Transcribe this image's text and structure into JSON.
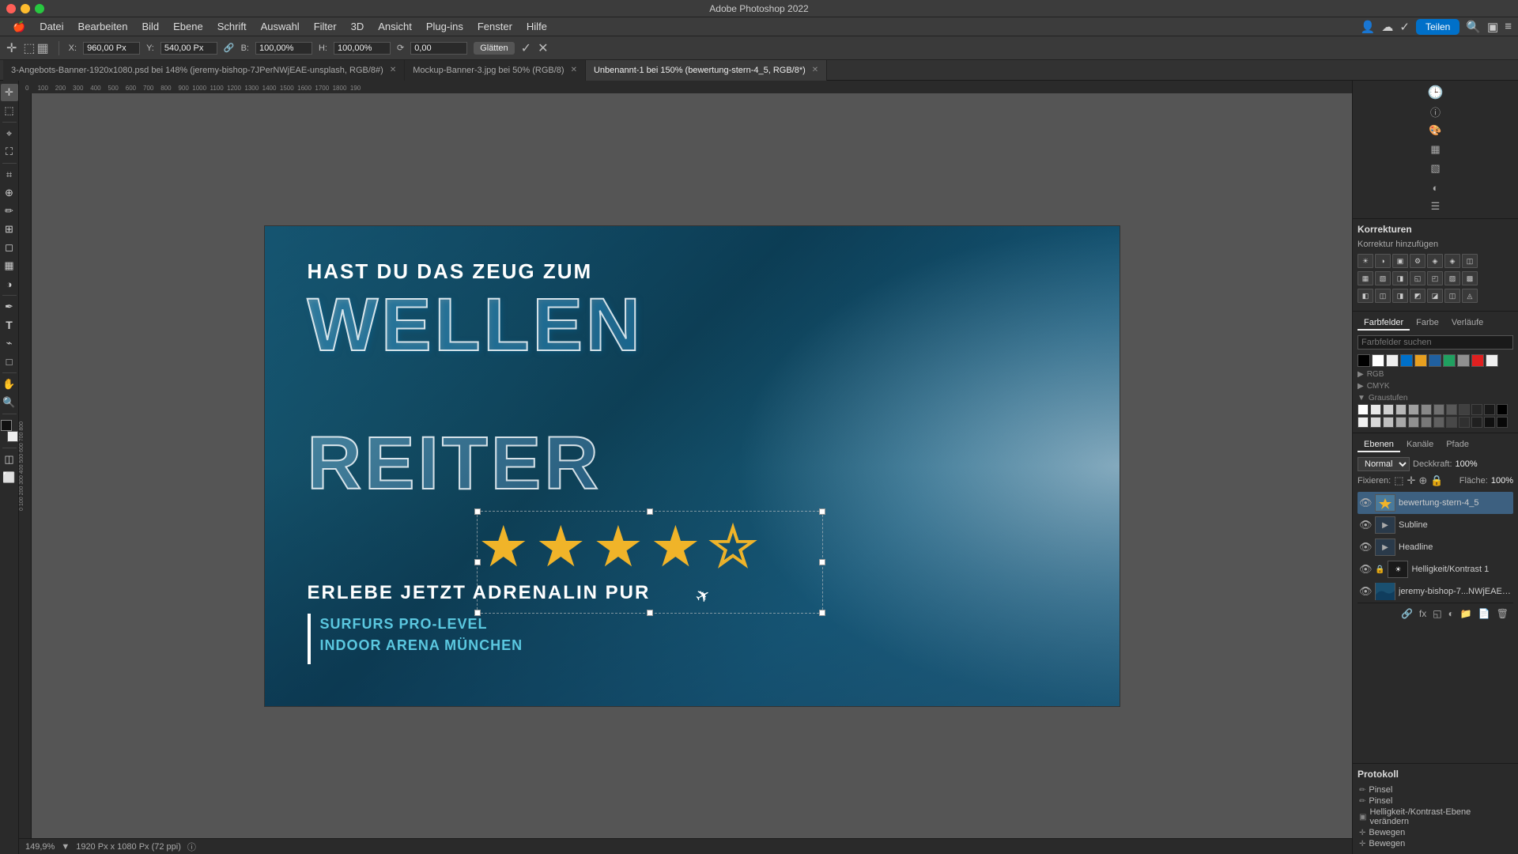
{
  "titlebar": {
    "title": "Adobe Photoshop 2022"
  },
  "menubar": {
    "items": [
      "",
      "Datei",
      "Bearbeiten",
      "Bild",
      "Ebene",
      "Schrift",
      "Auswahl",
      "Filter",
      "3D",
      "Ansicht",
      "Plug-ins",
      "Fenster",
      "Hilfe"
    ]
  },
  "optionsbar": {
    "x_label": "X:",
    "x_value": "960,00 Px",
    "y_label": "Y:",
    "y_value": "540,00 Px",
    "b_label": "B:",
    "b_value": "100,00%",
    "h_label": "H:",
    "h_value": "100,00%",
    "angle_label": "∆",
    "angle_value": "0,00",
    "mode_label": "Glätten",
    "share_label": "Teilen"
  },
  "tabs": [
    {
      "label": "3-Angebots-Banner-1920x1080.psd bei 148% (jeremy-bishop-7JPerNWjEAE-unsplash, RGB/8#)",
      "active": false,
      "closable": true
    },
    {
      "label": "Mockup-Banner-3.jpg bei 50% (RGB/8)",
      "active": false,
      "closable": true
    },
    {
      "label": "Unbenannt-1 bei 150% (bewertung-stern-4_5, RGB/8*)",
      "active": true,
      "closable": true
    }
  ],
  "canvas": {
    "headline": "HAST DU DAS ZEUG ZUM",
    "big_text_1": "WELLEN",
    "big_text_2": "REITER",
    "stars": [
      "filled",
      "filled",
      "filled",
      "filled",
      "empty"
    ],
    "bottom_headline": "ERLEBE JETZT ADRENALIN PUR",
    "sub_line1": "SURFURS PRO-LEVEL",
    "sub_line2": "INDOOR ARENA MÜNCHEN"
  },
  "right_panel": {
    "korrekturen": {
      "title": "Korrekturen",
      "subtitle": "Korrektur hinzufügen",
      "icon_rows": [
        [
          "☀",
          "◑",
          "▣",
          "⚙",
          "◈",
          "◈",
          "◫"
        ],
        [
          "▦",
          "▧",
          "◨",
          "◱",
          "◰",
          "▨",
          "▩"
        ],
        [
          "◧",
          "◫",
          "◨",
          "◩",
          "◪",
          "◫",
          "◬"
        ]
      ]
    },
    "farbfelder": {
      "tabs": [
        "Farbfelder",
        "Farbe",
        "Verläufe"
      ],
      "active_tab": "Farbfelder",
      "search_placeholder": "Farbfelder suchen",
      "swatches_row1": [
        "#000000",
        "#ffffff",
        "#ffffff",
        "#0070c9",
        "#e8a020",
        "#2060a0",
        "#20a060",
        "#909090",
        "#e02020",
        "#f0f0f0"
      ],
      "groups": [
        {
          "label": "RGB",
          "expanded": false
        },
        {
          "label": "CMYK",
          "expanded": false
        },
        {
          "label": "Graustufen",
          "expanded": true,
          "swatches": [
            "#ffffff",
            "#e8e8e8",
            "#d0d0d0",
            "#b8b8b8",
            "#a0a0a0",
            "#888888",
            "#707070",
            "#585858",
            "#404040",
            "#282828",
            "#181818",
            "#000000",
            "#f0f0f0",
            "#d8d8d8",
            "#c0c0c0",
            "#a8a8a8",
            "#909090",
            "#787878",
            "#606060",
            "#484848",
            "#303030",
            "#202020",
            "#101010",
            "#080808"
          ]
        }
      ]
    },
    "ebenen": {
      "tabs": [
        "Ebenen",
        "Kanäle",
        "Pfade"
      ],
      "active_tab": "Ebenen",
      "blend_mode": "Normal",
      "opacity": "100%",
      "flaeche": "100%",
      "fixieren_label": "Fixieren:",
      "layers": [
        {
          "name": "bewertung-stern-4_5",
          "visible": true,
          "active": true,
          "type": "smart",
          "thumb_color": "#4a7a9b"
        },
        {
          "name": "Subline",
          "visible": true,
          "active": false,
          "type": "group",
          "indent": false
        },
        {
          "name": "Headline",
          "visible": true,
          "active": false,
          "type": "group",
          "indent": false
        },
        {
          "name": "Helligkeit/Kontrast 1",
          "visible": true,
          "active": false,
          "type": "adjustment",
          "has_lock": true
        },
        {
          "name": "jeremy-bishop-7...NWjEAE-unsplash",
          "visible": true,
          "active": false,
          "type": "smart",
          "thumb_color": "#2a6080"
        }
      ]
    },
    "protokoll": {
      "title": "Protokoll",
      "items": [
        "Pinsel",
        "Pinsel",
        "Helligkeit-/Kontrast-Ebene verändern",
        "Bewegen",
        "Bewegen"
      ]
    }
  },
  "statusbar": {
    "zoom": "149,9%",
    "size": "1920 Px x 1080 Px (72 ppi)"
  }
}
